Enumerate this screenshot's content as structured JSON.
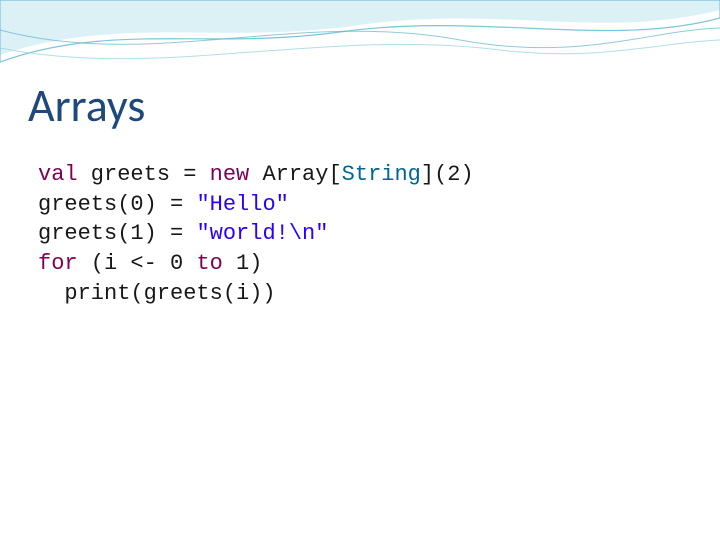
{
  "title": "Arrays",
  "code": {
    "l1": {
      "kw_val": "val",
      "name": " greets ",
      "eq": "= ",
      "kw_new": "new",
      "rest": " Array[",
      "type": "String",
      "close": "](2)"
    },
    "l2": {
      "lhs": "greets(0) = ",
      "str": "\"Hello\""
    },
    "l3": {
      "lhs": "greets(1) = ",
      "str": "\"world!\\n\""
    },
    "l4": {
      "kw_for": "for",
      "open": " (i <- 0 ",
      "kw_to": "to",
      "close": " 1)"
    },
    "l5": {
      "indent": "  print(greets(i))"
    }
  }
}
